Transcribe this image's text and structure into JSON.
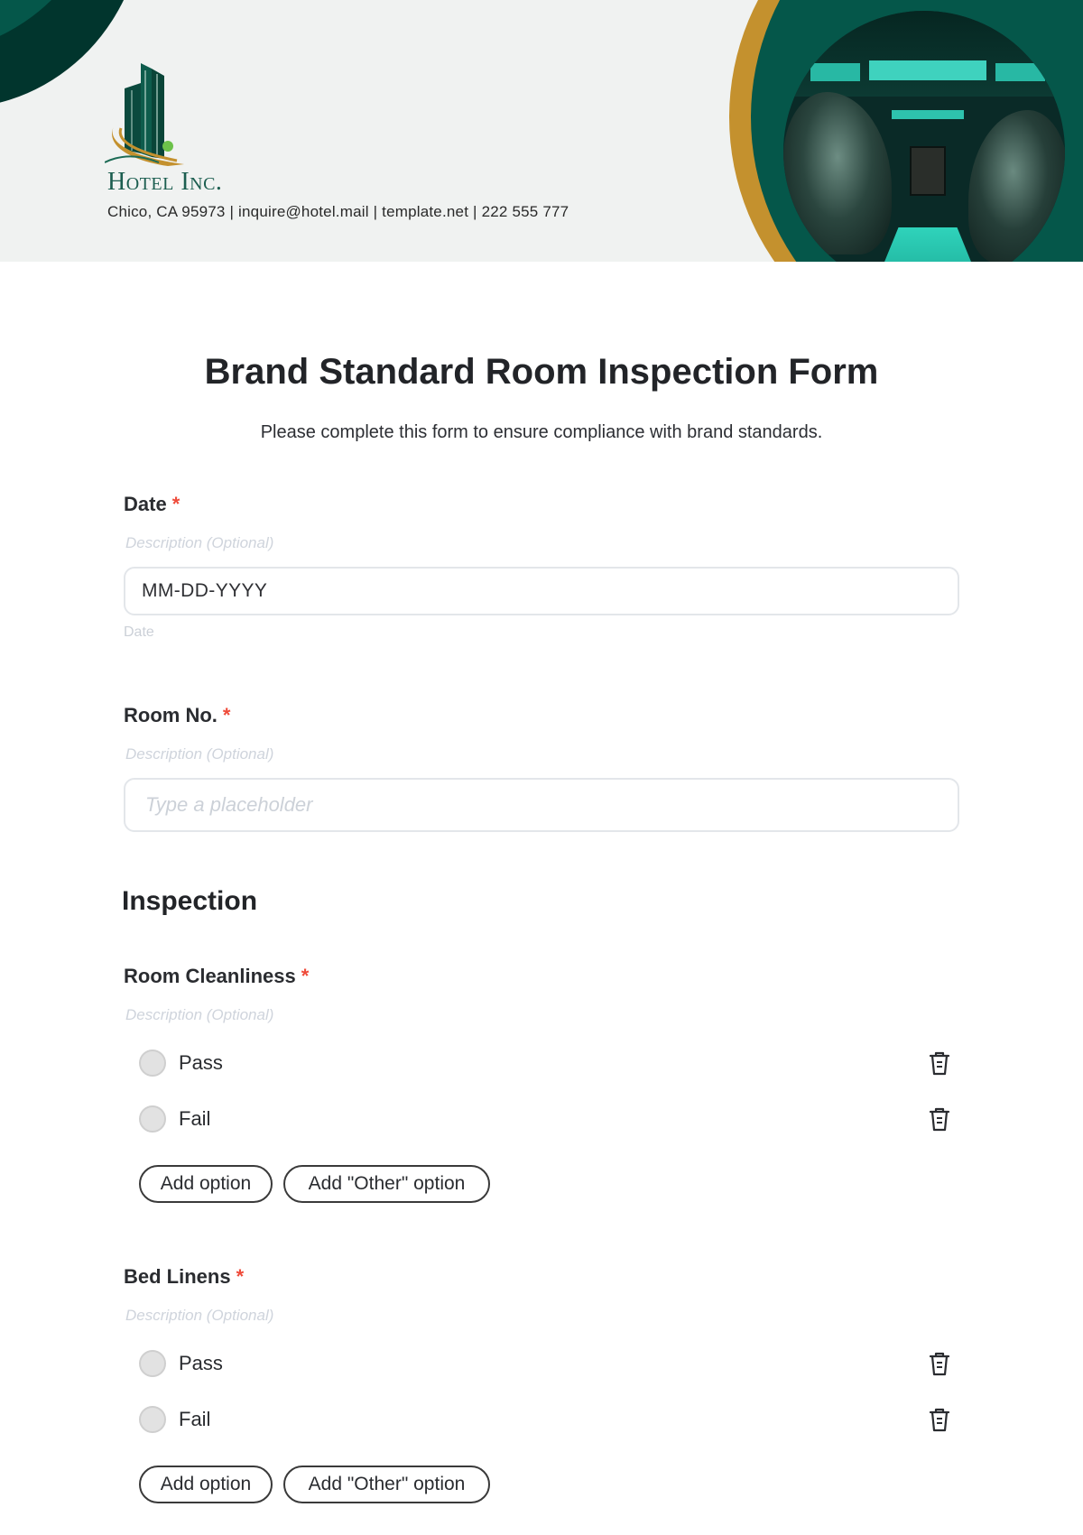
{
  "header": {
    "company_name": "Hotel Inc.",
    "contact_line": "Chico, CA 95973 | inquire@hotel.mail | template.net | 222 555 777",
    "logo_icon": "hotel-building-logo",
    "photo_alt": "indoor-pool-with-palms-photo",
    "colors": {
      "brand_green": "#05574a",
      "dark_green": "#01352d",
      "gold": "#c4912e",
      "banner_bg": "#f0f2f1"
    }
  },
  "form": {
    "title": "Brand Standard Room Inspection Form",
    "subtitle": "Please complete this form to ensure compliance with brand standards.",
    "required_marker": "*",
    "fields": [
      {
        "label": "Date",
        "description_placeholder": "Description (Optional)",
        "value": "MM-DD-YYYY",
        "hint": "Date"
      },
      {
        "label": "Room No.",
        "description_placeholder": "Description (Optional)",
        "placeholder": "Type a placeholder"
      }
    ],
    "section_title": "Inspection",
    "questions": [
      {
        "label": "Room Cleanliness",
        "description_placeholder": "Description (Optional)",
        "options": [
          {
            "label": "Pass",
            "selected": false
          },
          {
            "label": "Fail",
            "selected": false
          }
        ],
        "add_option_label": "Add option",
        "add_other_label": "Add \"Other\" option"
      },
      {
        "label": "Bed Linens",
        "description_placeholder": "Description (Optional)",
        "options": [
          {
            "label": "Pass",
            "selected": false
          },
          {
            "label": "Fail",
            "selected": false
          }
        ],
        "add_option_label": "Add option",
        "add_other_label": "Add \"Other\" option"
      }
    ],
    "colors": {
      "required": "#ef4b3a",
      "placeholder": "#ccd1d8",
      "border": "#e3e6ea"
    }
  }
}
